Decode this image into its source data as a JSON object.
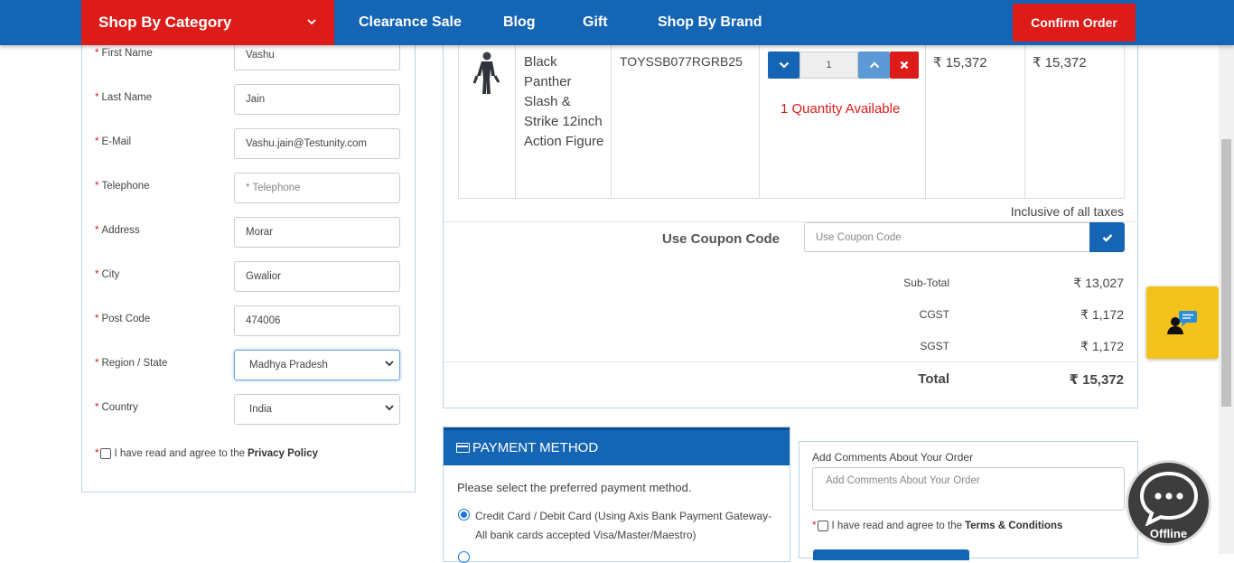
{
  "nav": {
    "category_label": "Shop By Category",
    "items": [
      "Clearance Sale",
      "Blog",
      "Gift",
      "Shop By Brand"
    ],
    "confirm_label": "Confirm Order"
  },
  "form": {
    "fields": [
      {
        "label": "First Name",
        "value": "Vashu"
      },
      {
        "label": "Last Name",
        "value": "Jain"
      },
      {
        "label": "E-Mail",
        "value": "Vashu.jain@Testunity.com"
      },
      {
        "label": "Telephone",
        "placeholder": "* Telephone"
      },
      {
        "label": "Address",
        "value": "Morar"
      },
      {
        "label": "City",
        "value": "Gwalior"
      },
      {
        "label": "Post Code",
        "value": "474006"
      },
      {
        "label": "Region / State",
        "value": "Madhya Pradesh"
      },
      {
        "label": "Country",
        "value": "India"
      }
    ],
    "privacy_text": "I have read and agree to the",
    "privacy_link": "Privacy Policy",
    "required_mark": "*"
  },
  "cart": {
    "product": {
      "name": "Black Panther Slash & Strike 12inch Action Figure",
      "model": "TOYSSB077RGRB25",
      "quantity": "1",
      "availability": "1 Quantity Available",
      "unit_price": "₹ 15,372",
      "total_price": "₹ 15,372"
    },
    "tax_note": "Inclusive of all taxes",
    "coupon_label": "Use Coupon Code",
    "coupon_placeholder": "Use Coupon Code",
    "totals": [
      {
        "label": "Sub-Total",
        "value": "₹ 13,027"
      },
      {
        "label": "CGST",
        "value": "₹ 1,172"
      },
      {
        "label": "SGST",
        "value": "₹ 1,172"
      },
      {
        "label": "Total",
        "value": "₹ 15,372"
      }
    ]
  },
  "payment": {
    "title": "PAYMENT METHOD",
    "subtitle": "Please select the preferred payment method.",
    "option": "Credit Card / Debit Card (Using Axis Bank Payment Gateway- All bank cards accepted Visa/Master/Maestro)"
  },
  "comments": {
    "label": "Add Comments About Your Order",
    "placeholder": "Add Comments About Your Order",
    "terms_text": "I have read and agree to the",
    "terms_link": "Terms & Conditions"
  },
  "chat": {
    "status": "Offline"
  },
  "colors": {
    "brand_blue": "#1565b5",
    "brand_red": "#dd1c1a",
    "chat_yellow": "#f4c31b"
  }
}
